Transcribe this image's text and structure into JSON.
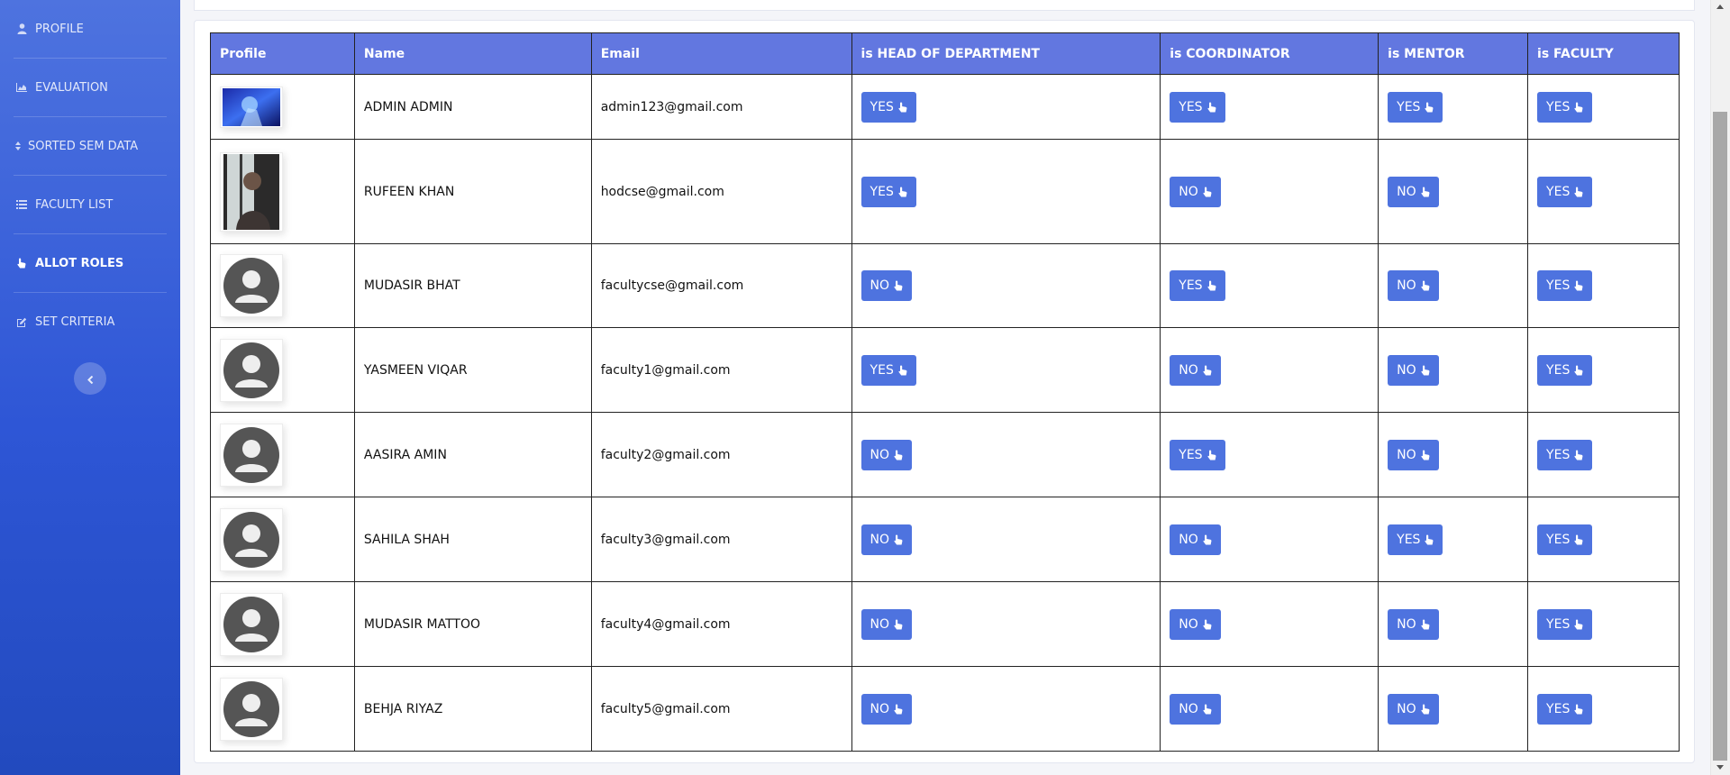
{
  "sidebar": {
    "items": [
      {
        "label": "PROFILE",
        "icon": "user-icon",
        "active": false
      },
      {
        "label": "EVALUATION",
        "icon": "area-chart-icon",
        "active": false
      },
      {
        "label": "SORTED SEM DATA",
        "icon": "sort-icon",
        "active": false
      },
      {
        "label": "FACULTY LIST",
        "icon": "list-icon",
        "active": false
      },
      {
        "label": "ALLOT ROLES",
        "icon": "hand-pointer-icon",
        "active": true
      },
      {
        "label": "SET CRITERIA",
        "icon": "edit-icon",
        "active": false
      }
    ],
    "toggle_icon": "chevron-left-icon"
  },
  "table": {
    "headers": [
      "Profile",
      "Name",
      "Email",
      "is HEAD OF DEPARTMENT",
      "is COORDINATOR",
      "is MENTOR",
      "is FACULTY"
    ],
    "rows": [
      {
        "photo": "photo-thumbnail",
        "name": "ADMIN ADMIN",
        "email": "admin123@gmail.com",
        "hod": "YES",
        "coordinator": "YES",
        "mentor": "YES",
        "faculty": "YES"
      },
      {
        "photo": "photo-thumbnail",
        "name": "RUFEEN KHAN",
        "email": "hodcse@gmail.com",
        "hod": "YES",
        "coordinator": "NO",
        "mentor": "NO",
        "faculty": "YES"
      },
      {
        "photo": "default-avatar",
        "name": "MUDASIR BHAT",
        "email": "facultycse@gmail.com",
        "hod": "NO",
        "coordinator": "YES",
        "mentor": "NO",
        "faculty": "YES"
      },
      {
        "photo": "default-avatar",
        "name": "YASMEEN VIQAR",
        "email": "faculty1@gmail.com",
        "hod": "YES",
        "coordinator": "NO",
        "mentor": "NO",
        "faculty": "YES"
      },
      {
        "photo": "default-avatar",
        "name": "AASIRA AMIN",
        "email": "faculty2@gmail.com",
        "hod": "NO",
        "coordinator": "YES",
        "mentor": "NO",
        "faculty": "YES"
      },
      {
        "photo": "default-avatar",
        "name": "SAHILA SHAH",
        "email": "faculty3@gmail.com",
        "hod": "NO",
        "coordinator": "NO",
        "mentor": "YES",
        "faculty": "YES"
      },
      {
        "photo": "default-avatar",
        "name": "MUDASIR MATTOO",
        "email": "faculty4@gmail.com",
        "hod": "NO",
        "coordinator": "NO",
        "mentor": "NO",
        "faculty": "YES"
      },
      {
        "photo": "default-avatar",
        "name": "BEHJA RIYAZ",
        "email": "faculty5@gmail.com",
        "hod": "NO",
        "coordinator": "NO",
        "mentor": "NO",
        "faculty": "YES"
      }
    ],
    "button_icon": "hand-pointer-icon"
  },
  "colors": {
    "sidebar_top": "#4e73df",
    "sidebar_bottom": "#224abe",
    "header_bg": "#6277e0",
    "button_bg": "#4e73df"
  }
}
